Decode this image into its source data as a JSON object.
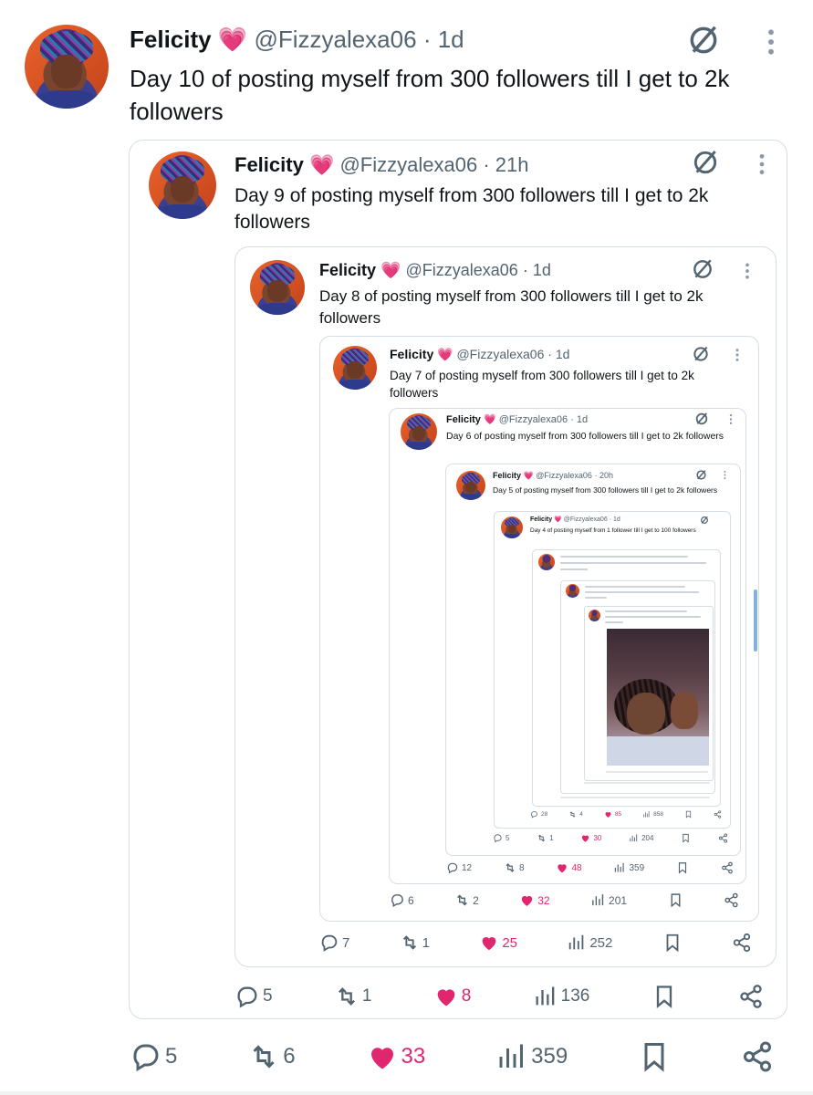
{
  "posts": [
    {
      "name": "Felicity",
      "heart": "💗",
      "handle": "@Fizzyalexa06",
      "time": "· 1d",
      "text": "Day 10 of posting myself from 300 followers till I get to 2k followers",
      "stats": {
        "replies": "5",
        "reposts": "6",
        "likes": "33",
        "views": "359"
      }
    },
    {
      "name": "Felicity",
      "heart": "💗",
      "handle": "@Fizzyalexa06",
      "time": "· 21h",
      "text": "Day 9 of posting myself from 300 followers till I get to 2k followers",
      "stats": {
        "replies": "5",
        "reposts": "1",
        "likes": "8",
        "views": "136"
      }
    },
    {
      "name": "Felicity",
      "heart": "💗",
      "handle": "@Fizzyalexa06",
      "time": "· 1d",
      "text": "Day 8 of posting myself from 300 followers till I get to 2k followers",
      "stats": {
        "replies": "7",
        "reposts": "1",
        "likes": "25",
        "views": "252"
      }
    },
    {
      "name": "Felicity",
      "heart": "💗",
      "handle": "@Fizzyalexa06",
      "time": "· 1d",
      "text": "Day 7 of posting myself from 300 followers till I get to 2k followers",
      "stats": {
        "replies": "6",
        "reposts": "2",
        "likes": "32",
        "views": "201"
      }
    },
    {
      "name": "Felicity",
      "heart": "💗",
      "handle": "@Fizzyalexa06",
      "time": "· 1d",
      "text": "Day 6 of posting myself from 300 followers till I get to 2k followers",
      "stats": {
        "replies": "12",
        "reposts": "8",
        "likes": "48",
        "views": "359"
      }
    },
    {
      "name": "Felicity",
      "heart": "💗",
      "handle": "@Fizzyalexa06",
      "time": "· 20h",
      "text": "Day 5 of posting myself from 300 followers till I get to 2k followers",
      "stats": {
        "replies": "5",
        "reposts": "1",
        "likes": "30",
        "views": "204"
      }
    },
    {
      "name": "Felicity",
      "heart": "💗",
      "handle": "@Fizzyalexa06",
      "time": "· 1d",
      "text": "Day 4 of posting myself from 1 follower till I get to 100 followers",
      "stats": {
        "replies": "28",
        "reposts": "4",
        "likes": "85",
        "views": "858"
      }
    }
  ],
  "colors": {
    "like": "#e0266f",
    "muted": "#536471",
    "border": "#d6dde3",
    "text": "#0f1419",
    "heart": "#f05aa6"
  }
}
